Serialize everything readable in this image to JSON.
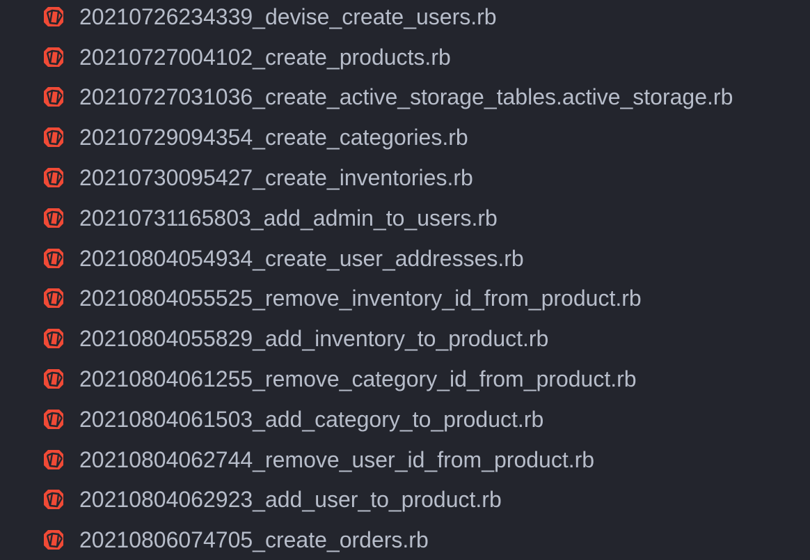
{
  "theme": {
    "background": "#23252d",
    "text": "#b7bdca",
    "icon_accent": "#f04a36"
  },
  "files": [
    {
      "name": "20210726234339_devise_create_users.rb",
      "icon": "ruby-file-icon"
    },
    {
      "name": "20210727004102_create_products.rb",
      "icon": "ruby-file-icon"
    },
    {
      "name": "20210727031036_create_active_storage_tables.active_storage.rb",
      "icon": "ruby-file-icon"
    },
    {
      "name": "20210729094354_create_categories.rb",
      "icon": "ruby-file-icon"
    },
    {
      "name": "20210730095427_create_inventories.rb",
      "icon": "ruby-file-icon"
    },
    {
      "name": "20210731165803_add_admin_to_users.rb",
      "icon": "ruby-file-icon"
    },
    {
      "name": "20210804054934_create_user_addresses.rb",
      "icon": "ruby-file-icon"
    },
    {
      "name": "20210804055525_remove_inventory_id_from_product.rb",
      "icon": "ruby-file-icon"
    },
    {
      "name": "20210804055829_add_inventory_to_product.rb",
      "icon": "ruby-file-icon"
    },
    {
      "name": "20210804061255_remove_category_id_from_product.rb",
      "icon": "ruby-file-icon"
    },
    {
      "name": "20210804061503_add_category_to_product.rb",
      "icon": "ruby-file-icon"
    },
    {
      "name": "20210804062744_remove_user_id_from_product.rb",
      "icon": "ruby-file-icon"
    },
    {
      "name": "20210804062923_add_user_to_product.rb",
      "icon": "ruby-file-icon"
    },
    {
      "name": "20210806074705_create_orders.rb",
      "icon": "ruby-file-icon"
    }
  ]
}
